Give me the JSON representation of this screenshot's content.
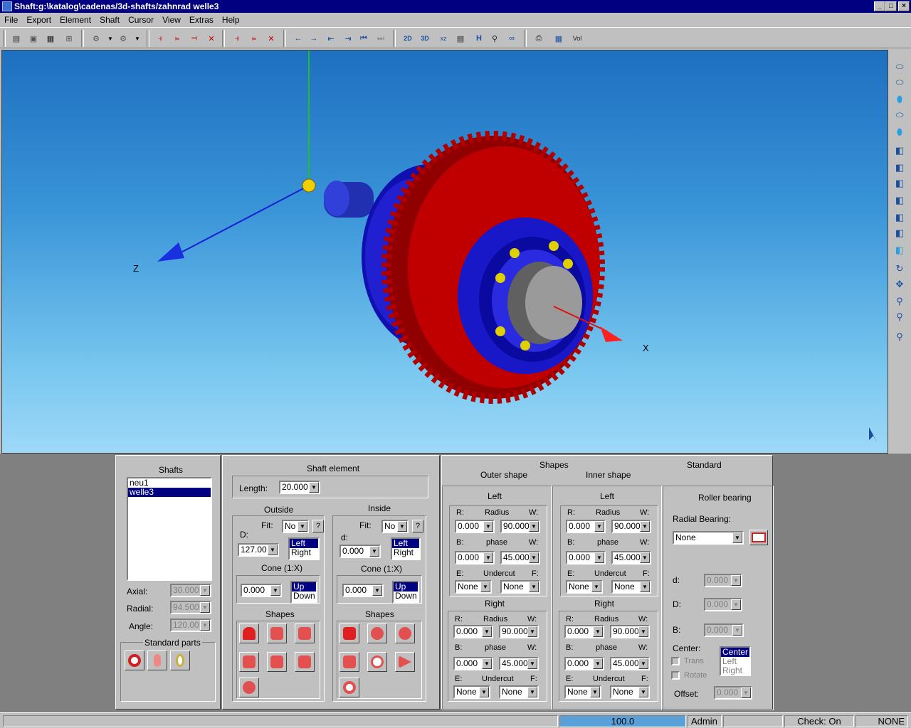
{
  "window": {
    "title": "Shaft:g:\\katalog\\cadenas/3d-shafts/zahnrad  welle3"
  },
  "menu": [
    "File",
    "Export",
    "Element",
    "Shaft",
    "Cursor",
    "View",
    "Extras",
    "Help"
  ],
  "viewport": {
    "axis_x": "X",
    "axis_z": "Z"
  },
  "shafts": {
    "title": "Shafts",
    "items": [
      "neu1",
      "welle3"
    ],
    "selected": 1,
    "axial_label": "Axial:",
    "axial_value": "30.000",
    "radial_label": "Radial:",
    "radial_value": "94.500",
    "angle_label": "Angle:",
    "angle_value": "120.00",
    "std_parts_title": "Standard parts"
  },
  "element": {
    "title": "Shaft element",
    "length_label": "Length:",
    "length_value": "20.000",
    "outside": {
      "title": "Outside",
      "fit_label": "Fit:",
      "fit_value": "No",
      "help": "?",
      "d_label": "D:",
      "d_value": "127.00",
      "lr": [
        "Left",
        "Right"
      ],
      "cone_label": "Cone (1:X)",
      "cone_value": "0.000",
      "ud": [
        "Up",
        "Down"
      ],
      "shapes_label": "Shapes"
    },
    "inside": {
      "title": "Inside",
      "fit_label": "Fit:",
      "fit_value": "No",
      "help": "?",
      "d_label": "d:",
      "d_value": "0.000",
      "lr": [
        "Left",
        "Right"
      ],
      "cone_label": "Cone (1:X)",
      "cone_value": "0.000",
      "ud": [
        "Up",
        "Down"
      ],
      "shapes_label": "Shapes"
    }
  },
  "shapes": {
    "title": "Shapes",
    "outer_label": "Outer shape",
    "inner_label": "Inner shape",
    "standard_label": "Standard",
    "outer_left": {
      "title": "Left",
      "r": "R:",
      "radius": "Radius",
      "w": "W:",
      "r_val": "0.000",
      "w_val": "90.000",
      "b": "B:",
      "phase": "phase",
      "w2": "W:",
      "b_val": "0.000",
      "w2_val": "45.000",
      "e": "E:",
      "undercut": "Undercut",
      "f": "F:",
      "e_val": "None",
      "f_val": "None"
    },
    "outer_right": {
      "title": "Right",
      "r": "R:",
      "radius": "Radius",
      "w": "W:",
      "r_val": "0.000",
      "w_val": "90.000",
      "b": "B:",
      "phase": "phase",
      "w2": "W:",
      "b_val": "0.000",
      "w2_val": "45.000",
      "e": "E:",
      "undercut": "Undercut",
      "f": "F:",
      "e_val": "None",
      "f_val": "None"
    },
    "inner_left": {
      "title": "Left",
      "r": "R:",
      "radius": "Radius",
      "w": "W:",
      "r_val": "0.000",
      "w_val": "90.000",
      "b": "B:",
      "phase": "phase",
      "w2": "W:",
      "b_val": "0.000",
      "w2_val": "45.000",
      "e": "E:",
      "undercut": "Undercut",
      "f": "F:",
      "e_val": "None",
      "f_val": "None"
    },
    "inner_right": {
      "title": "Right",
      "r": "R:",
      "radius": "Radius",
      "w": "W:",
      "r_val": "0.000",
      "w_val": "90.000",
      "b": "B:",
      "phase": "phase",
      "w2": "W:",
      "b_val": "0.000",
      "w2_val": "45.000",
      "e": "E:",
      "undercut": "Undercut",
      "f": "F:",
      "e_val": "None",
      "f_val": "None"
    }
  },
  "standard": {
    "title": "Roller bearing",
    "radial_label": "Radial Bearing:",
    "radial_value": "None",
    "d_label": "d:",
    "d_val": "0.000",
    "D_label": "D:",
    "D_val": "0.000",
    "B_label": "B:",
    "B_val": "0.000",
    "center_label": "Center:",
    "trans_label": "Trans",
    "rotate_label": "Rotate",
    "center_opts": [
      "Center",
      "Left",
      "Right"
    ],
    "offset_label": "Offset:",
    "offset_val": "0.000"
  },
  "status": {
    "progress": "100.0",
    "user": "Admin",
    "check": "Check: On",
    "mode": "NONE"
  },
  "colors": {
    "gear": "#c00000",
    "bearing": "#1010c8",
    "title_bar": "#000080",
    "face": "#c0c0c0"
  }
}
